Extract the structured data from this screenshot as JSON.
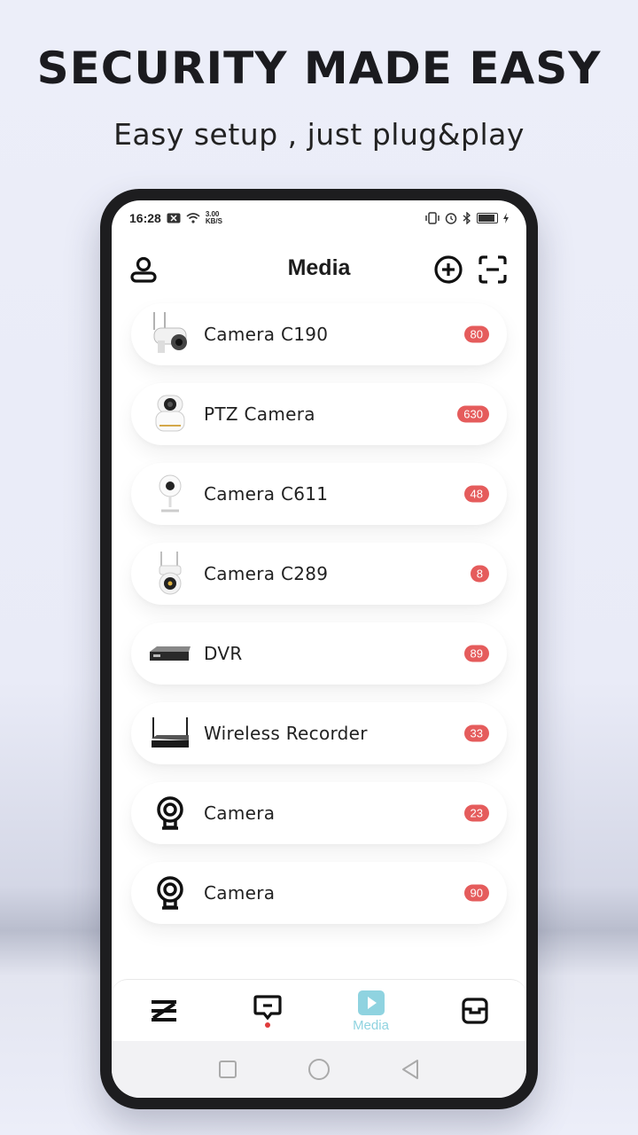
{
  "promo": {
    "headline": "SECURITY MADE EASY",
    "subline": "Easy setup , just plug&play"
  },
  "status": {
    "time": "16:28",
    "net_speed_top": "3.00",
    "net_speed_bottom": "KB/S"
  },
  "header": {
    "title": "Media",
    "left_icon": "user-icon",
    "right_icons": [
      "add-circle-icon",
      "scan-icon"
    ]
  },
  "devices": [
    {
      "name": "Camera C190",
      "count": "80",
      "icon": "bullet-camera"
    },
    {
      "name": "PTZ Camera",
      "count": "630",
      "icon": "ptz-camera"
    },
    {
      "name": "Camera C611",
      "count": "48",
      "icon": "mini-camera"
    },
    {
      "name": "Camera C289",
      "count": "8",
      "icon": "dome-camera"
    },
    {
      "name": "DVR",
      "count": "89",
      "icon": "dvr"
    },
    {
      "name": "Wireless Recorder",
      "count": "33",
      "icon": "nvr"
    },
    {
      "name": "Camera",
      "count": "23",
      "icon": "webcam-icon"
    },
    {
      "name": "Camera",
      "count": "90",
      "icon": "webcam-icon"
    }
  ],
  "tabs": [
    {
      "id": "home",
      "label": "",
      "icon": "z-logo-icon"
    },
    {
      "id": "messages",
      "label": "",
      "icon": "message-icon",
      "has_dot": true
    },
    {
      "id": "media",
      "label": "Media",
      "icon": "play-icon",
      "active": true
    },
    {
      "id": "devices",
      "label": "",
      "icon": "device-icon"
    }
  ],
  "colors": {
    "badge": "#e55c5c",
    "accent": "#8fd3e0",
    "text": "#222222"
  }
}
